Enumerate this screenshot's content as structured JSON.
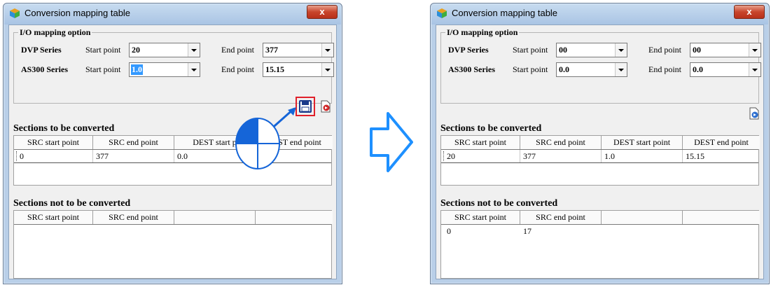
{
  "windows": [
    {
      "title": "Conversion mapping table",
      "close_label": "x",
      "io_legend": "I/O mapping option",
      "dvp_label": "DVP Series",
      "as300_label": "AS300 Series",
      "start_label": "Start point",
      "end_label": "End point",
      "dvp_start": "20",
      "dvp_end": "377",
      "as300_start": "1.0",
      "as300_end": "15.15",
      "convert_title": "Sections to be converted",
      "convert_headers": [
        "SRC start point",
        "SRC end point",
        "DEST start p",
        "DEST end point"
      ],
      "convert_row": [
        "0",
        "377",
        "0.0",
        "5.15"
      ],
      "noconvert_title": "Sections not to be converted",
      "noconvert_headers": [
        "SRC start point",
        "SRC end point",
        "",
        ""
      ],
      "noconvert_row": [
        "",
        ""
      ]
    },
    {
      "title": "Conversion mapping table",
      "close_label": "x",
      "io_legend": "I/O mapping option",
      "dvp_label": "DVP Series",
      "as300_label": "AS300 Series",
      "start_label": "Start point",
      "end_label": "End point",
      "dvp_start": "00",
      "dvp_end": "00",
      "as300_start": "0.0",
      "as300_end": "0.0",
      "convert_title": "Sections to be converted",
      "convert_headers": [
        "SRC start point",
        "SRC end point",
        "DEST start point",
        "DEST end point"
      ],
      "convert_row": [
        "20",
        "377",
        "1.0",
        "15.15"
      ],
      "noconvert_title": "Sections not to be converted",
      "noconvert_headers": [
        "SRC start point",
        "SRC end point",
        "",
        ""
      ],
      "noconvert_row": [
        "0",
        "17"
      ]
    }
  ],
  "colors": {
    "highlight_box": "#e0202a",
    "arrow_fill": "#1e90ff",
    "pointer_fill": "#1565d8"
  },
  "icons": [
    "app-cube-icon",
    "save-icon",
    "import-file-icon",
    "mouse-pointer-icon",
    "right-arrow-icon"
  ]
}
